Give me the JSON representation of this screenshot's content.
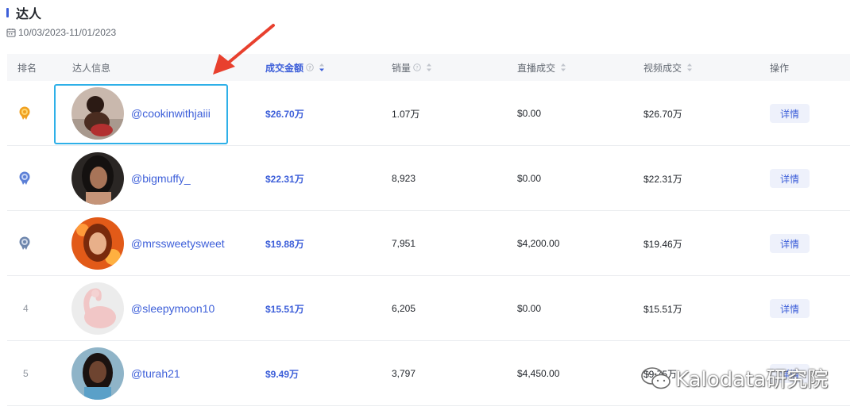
{
  "header": {
    "title": "达人",
    "date_range": "10/03/2023-11/01/2023"
  },
  "columns": {
    "rank": "排名",
    "creator": "达人信息",
    "gmv": "成交金额",
    "sales": "销量",
    "live_gmv": "直播成交",
    "video_gmv": "视频成交",
    "action": "操作"
  },
  "rows": [
    {
      "rank": "",
      "medal": "gold",
      "handle": "@cookinwithjaiii",
      "gmv": "$26.70万",
      "sales": "1.07万",
      "live_gmv": "$0.00",
      "video_gmv": "$26.70万",
      "action": "详情"
    },
    {
      "rank": "",
      "medal": "silver",
      "handle": "@bigmuffy_",
      "gmv": "$22.31万",
      "sales": "8,923",
      "live_gmv": "$0.00",
      "video_gmv": "$22.31万",
      "action": "详情"
    },
    {
      "rank": "",
      "medal": "bronze",
      "handle": "@mrssweetysweet",
      "gmv": "$19.88万",
      "sales": "7,951",
      "live_gmv": "$4,200.00",
      "video_gmv": "$19.46万",
      "action": "详情"
    },
    {
      "rank": "4",
      "medal": "",
      "handle": "@sleepymoon10",
      "gmv": "$15.51万",
      "sales": "6,205",
      "live_gmv": "$0.00",
      "video_gmv": "$15.51万",
      "action": "详情"
    },
    {
      "rank": "5",
      "medal": "",
      "handle": "@turah21",
      "gmv": "$9.49万",
      "sales": "3,797",
      "live_gmv": "$4,450.00",
      "video_gmv": "$9.75万",
      "action": "详情"
    }
  ],
  "watermark": "Kalodata研究院",
  "colors": {
    "accent": "#3d5fd9",
    "highlight_border": "#2eb0e8",
    "arrow": "#e8402e",
    "gold": "#f0a020",
    "silver": "#5b7fd6"
  }
}
